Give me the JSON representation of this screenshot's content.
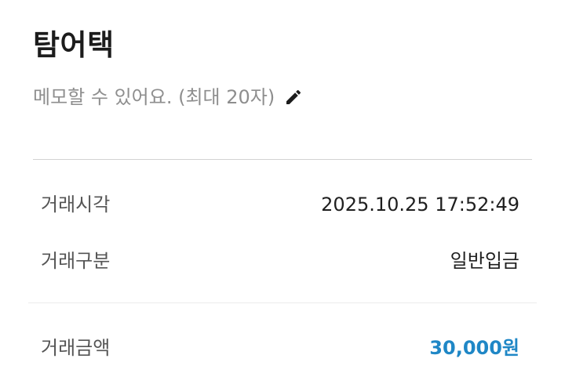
{
  "header": {
    "title": "탐어택"
  },
  "memo": {
    "placeholder": "메모할 수 있어요. (최대 20자)",
    "edit_icon": "pencil-icon"
  },
  "details": {
    "time_label": "거래시각",
    "time_value": "2025.10.25 17:52:49",
    "type_label": "거래구분",
    "type_value": "일반입금",
    "amount_label": "거래금액",
    "amount_value": "30,000원"
  },
  "colors": {
    "amount": "#1f87c6",
    "placeholder": "#8e8e8e",
    "divider": "#d2d2d2"
  }
}
